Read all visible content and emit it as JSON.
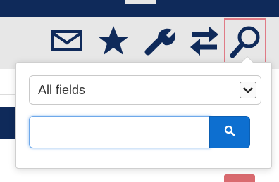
{
  "toolbar": {
    "icons": [
      {
        "name": "mail-icon"
      },
      {
        "name": "star-icon"
      },
      {
        "name": "wrench-icon"
      },
      {
        "name": "swap-arrows-icon"
      },
      {
        "name": "search-icon"
      }
    ],
    "icon_color": "#0f2a5a",
    "highlight_color": "#e07b86"
  },
  "search_popover": {
    "field_select": {
      "selected": "All fields"
    },
    "search": {
      "value": "",
      "placeholder": ""
    },
    "submit_icon": "search-icon",
    "button_color": "#0d6fd0"
  }
}
